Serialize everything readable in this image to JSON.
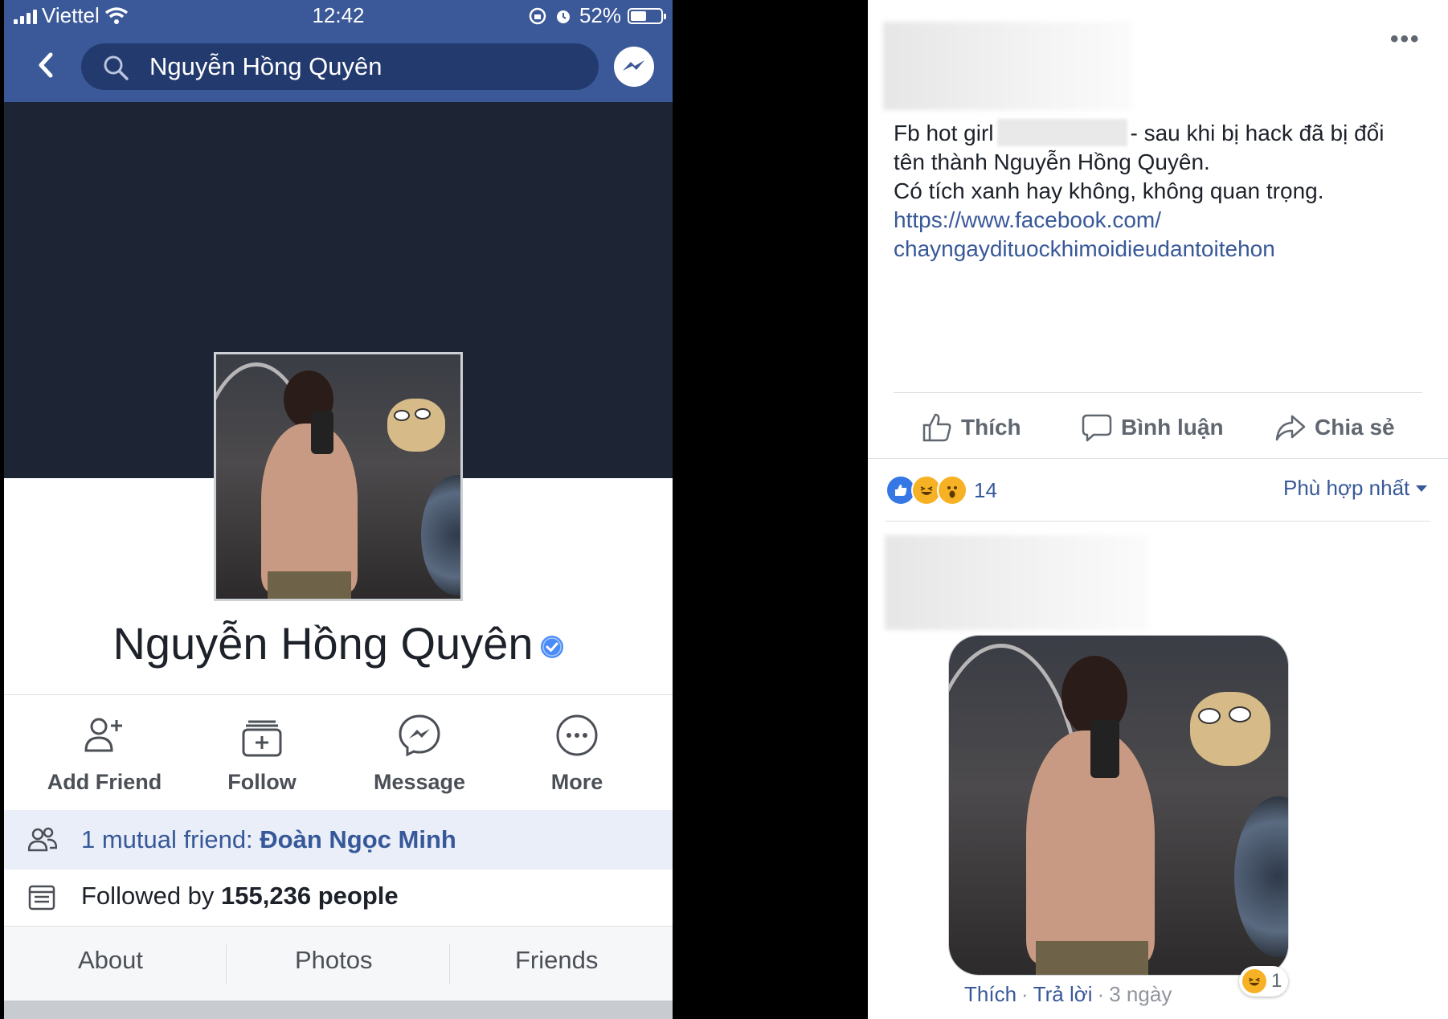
{
  "phone": {
    "status": {
      "carrier": "Viettel",
      "time": "12:42",
      "battery": "52%",
      "battery_level": 0.52
    },
    "search": {
      "query": "Nguyễn Hồng Quyên"
    },
    "profile": {
      "name": "Nguyễn Hồng Quyên",
      "actions": [
        {
          "label": "Add Friend",
          "icon": "add-friend-icon"
        },
        {
          "label": "Follow",
          "icon": "follow-icon"
        },
        {
          "label": "Message",
          "icon": "messenger-icon"
        },
        {
          "label": "More",
          "icon": "more-icon"
        }
      ],
      "mutual_prefix": "1 mutual friend: ",
      "mutual_name": "Đoàn Ngọc Minh",
      "followed_prefix": "Followed by ",
      "followed_count": "155,236 people"
    },
    "tabs": [
      "About",
      "Photos",
      "Friends"
    ],
    "colors": {
      "header": "#3b5998",
      "cover": "#1d2434",
      "link": "#365899"
    }
  },
  "post": {
    "more": "•••",
    "text": {
      "line1_before": "Fb hot girl",
      "line1_after": "- sau khi bị hack đã bị đổi",
      "line2": "tên thành Nguyễn Hồng Quyên.",
      "line3": "Có tích xanh hay không, không quan trọng.",
      "link_line1": "https://www.facebook.com/",
      "link_line2": "chayngaydituockhimoidieudantoitehon"
    },
    "actions": {
      "like": "Thích",
      "comment": "Bình luận",
      "share": "Chia sẻ"
    },
    "reactions": {
      "icons": [
        "like",
        "haha",
        "wow"
      ],
      "count": "14"
    },
    "sort": "Phù hợp nhất",
    "comment": {
      "like": "Thích",
      "reply": "Trả lời",
      "time": "3 ngày",
      "reaction_count": "1"
    },
    "colors": {
      "link": "#385898",
      "like_blue": "#3578e5",
      "reaction_yellow": "#f7b125"
    }
  }
}
